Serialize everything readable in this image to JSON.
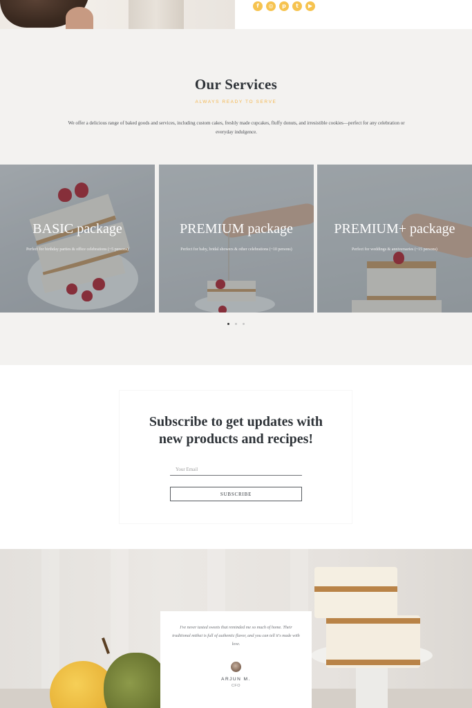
{
  "colors": {
    "accent": "#f6c34f",
    "services_bg": "#f3f2f0",
    "heading": "#2e3338",
    "subheading": "#f3b64d"
  },
  "social": {
    "icons": [
      "facebook-icon",
      "instagram-icon",
      "pinterest-icon",
      "twitter-icon",
      "youtube-icon"
    ]
  },
  "services": {
    "title": "Our Services",
    "subtitle": "ALWAYS READY TO SERVE",
    "description": "We offer a delicious range of baked goods and services, including custom cakes, freshly made cupcakes, fluffy donuts, and irresistible cookies—perfect for any celebration or everyday indulgence.",
    "packages": [
      {
        "title": "BASIC package",
        "description": "Perfect for birthday parties & office celebrations (~5 persons)"
      },
      {
        "title": "PREMIUM package",
        "description": "Perfect for baby, bridal showers & other celebrations (~10 persons)"
      },
      {
        "title": "PREMIUM+ package",
        "description": "Perfect for weddings & anniversaries (~15 persons)"
      }
    ],
    "carousel": {
      "pages": 3,
      "active": 1
    }
  },
  "subscribe": {
    "title_line1": "Subscribe to get updates with",
    "title_line2": "new products and recipes!",
    "email_placeholder": "Your Email",
    "button_label": "SUBSCRIBE"
  },
  "testimonial": {
    "quote": "I've never tasted sweets that reminded me so much of home. Their traditional mithai is full of authentic flavor, and you can tell it's made with love.",
    "name": "ARJUN M.",
    "role": "CFO"
  }
}
